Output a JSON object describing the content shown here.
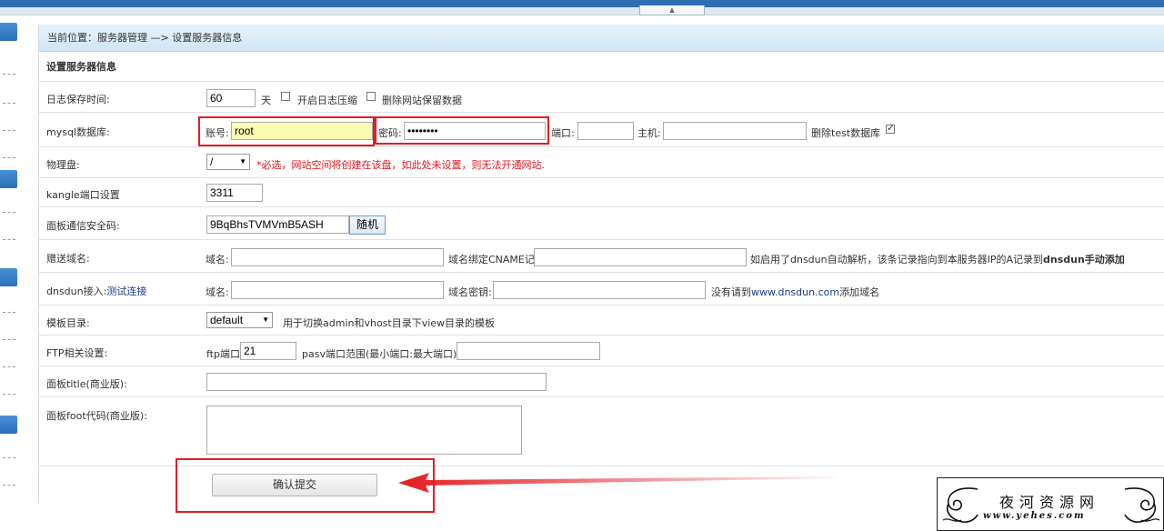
{
  "breadcrumb": {
    "text": "当前位置：服务器管理 —> 设置服务器信息"
  },
  "section_title": "设置服务器信息",
  "log_row": {
    "label": "日志保存时间:",
    "value": "60",
    "unit": "天",
    "compress_label": "开启日志压缩",
    "delete_label": "删除网站保留数据"
  },
  "mysql_row": {
    "label": "mysql数据库:",
    "account_label": "账号:",
    "account_value": "root",
    "password_label": "密码:",
    "password_value": "••••••••",
    "port_label": "端口:",
    "port_value": "",
    "host_label": "主机:",
    "host_value": "",
    "delete_test_label": "删除test数据库"
  },
  "disk_row": {
    "label": "物理盘:",
    "selected": "/",
    "note": "*必选，网站空间将创建在该盘，如此处未设置，则无法开通网站."
  },
  "kangle_row": {
    "label": "kangle端口设置",
    "value": "3311"
  },
  "secret_row": {
    "label": "面板通信安全码:",
    "value": "9BqBhsTVMVmB5ASH",
    "random_label": "随机"
  },
  "gift_row": {
    "label": "赠送域名:",
    "domain_label": "域名:",
    "domain_value": "",
    "cname_label": "域名绑定CNAME记录",
    "cname_value": "",
    "note_prefix": "如启用了dnsdun自动解析，该条记录指向到本服务器IP的A记录到",
    "note_bold": "dnsdun手动添加"
  },
  "dnsdun_row": {
    "label": "dnsdun接入:",
    "test_link": "测试连接",
    "domain_label": "域名:",
    "domain_value": "",
    "key_label": "域名密钥:",
    "key_value": "",
    "note_prefix": "没有请到",
    "note_url": "www.dnsdun.com",
    "note_suffix": "添加域名"
  },
  "template_row": {
    "label": "模板目录:",
    "selected": "default",
    "note": "用于切换admin和vhost目录下view目录的模板"
  },
  "ftp_row": {
    "label": "FTP相关设置:",
    "port_label": "ftp端口",
    "port_value": "21",
    "pasv_label": "pasv端口范围(最小端口:最大端口)",
    "pasv_value": ""
  },
  "title_row": {
    "label": "面板title(商业版):",
    "value": ""
  },
  "foot_row": {
    "label": "面板foot代码(商业版):"
  },
  "submit_label": "确认提交",
  "watermark": {
    "title": "夜河资源网",
    "url": "www.yehes.com"
  },
  "colors": {
    "accent": "#2f6fb1",
    "highlight": "#e31e24",
    "required_note": "#e0161c"
  }
}
